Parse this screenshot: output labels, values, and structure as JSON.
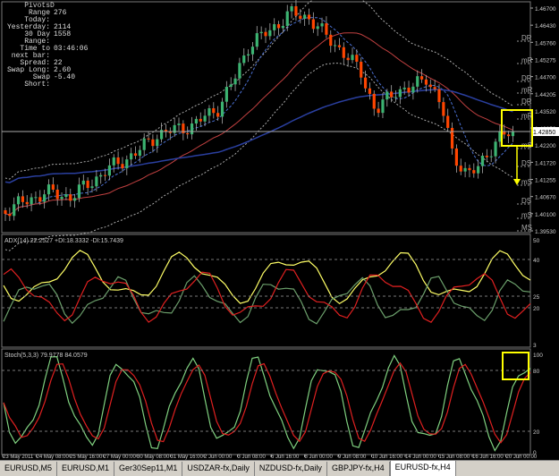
{
  "indicator_box": {
    "title": "PivotsD",
    "rows": [
      {
        "label": "Range Today:",
        "value": "276"
      },
      {
        "label": "Yesterday:",
        "value": "2114"
      },
      {
        "label": "30 Day Range:",
        "value": "1558"
      },
      {
        "label": "Time to next bar:",
        "value": "03:46:06"
      },
      {
        "label": "Spread:",
        "value": "22"
      },
      {
        "label": "Swap Long:",
        "value": "2.60"
      },
      {
        "label": "Swap Short:",
        "value": "-5.40"
      }
    ]
  },
  "price_axis": [
    "1.46700",
    "1.46430",
    "1.45760",
    "1.45275",
    "1.44700",
    "1.44205",
    "1.43520",
    "1.42850",
    "1.42200",
    "1.41720",
    "1.41255",
    "1.40670",
    "1.40100",
    "1.39530"
  ],
  "current_price": "1.42850",
  "pivot_labels": [
    "DR",
    "mR",
    "DR",
    "mR",
    "DR",
    "mR",
    "mS",
    "DS",
    "mS",
    "DS",
    "mS",
    "MS"
  ],
  "time_axis": [
    "23 May 2011",
    "24 May 08:00",
    "25 May 16:00",
    "27 May 00:00",
    "30 May 08:00",
    "31 May 16:00",
    "2 Jun 00:00",
    "3 Jun 08:00",
    "6 Jun 16:00",
    "8 Jun 00:00",
    "9 Jun 08:00",
    "10 Jun 16:00",
    "14 Jun 00:00",
    "15 Jun 08:00",
    "16 Jun 16:00",
    "20 Jun 00:00"
  ],
  "adx": {
    "label": "ADX(14) 22.2527 +DI:18.3332 -DI:15.7439",
    "levels": [
      "50",
      "40",
      "25",
      "20",
      "3"
    ]
  },
  "stoch": {
    "label": "Stoch(5,3,3) 79.9778 84.0579",
    "levels": [
      "100",
      "80",
      "20",
      "0"
    ]
  },
  "tabs": [
    "EURUSD,M5",
    "EURUSD,M1",
    "Ger30Sep11,M1",
    "USDZAR-fx,Daily",
    "NZDUSD-fx,Daily",
    "GBPJPY-fx,H4",
    "EURUSD-fx,H4"
  ],
  "active_tab": 6,
  "colors": {
    "bull": "#3cb371",
    "bear": "#ff4500",
    "adx": "#ffff66",
    "plus_di": "#6b9f6b",
    "minus_di": "#e02020",
    "highlight": "#ffff00",
    "grid": "#888888",
    "bg": "#000000"
  }
}
